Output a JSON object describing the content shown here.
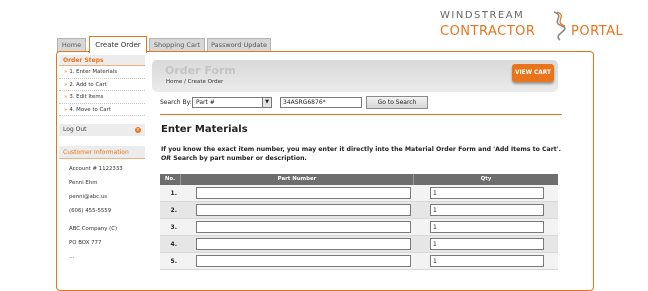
{
  "logo": {
    "line1": "WINDSTREAM",
    "line2": "CONTRACTOR",
    "line3": "PORTAL"
  },
  "tabs": [
    {
      "label": "Home"
    },
    {
      "label": "Create Order"
    },
    {
      "label": "Shopping Cart"
    },
    {
      "label": "Password Update"
    }
  ],
  "sidebar": {
    "order_steps_title": "Order Steps",
    "steps": [
      {
        "label": "1. Enter Materials"
      },
      {
        "label": "2. Add to Cart"
      },
      {
        "label": "3. Edit Items"
      },
      {
        "label": "4. Move to Cart"
      }
    ],
    "logout_label": "Log Out",
    "customer_info_title": "Customer Information",
    "customer": {
      "account": "Account # 1122333",
      "name": "Penni Ehm",
      "email": "penni@abc.us",
      "phone": "(606) 455-5559",
      "company": "ABC Company (C)",
      "po_box": "PO BOX 777",
      "extra": "..."
    }
  },
  "header": {
    "title": "Order Form",
    "breadcrumb": "Home / Create Order",
    "view_cart_label": "VIEW CART"
  },
  "search": {
    "label": "Search By:",
    "select_value": "Part #",
    "input_value": "34ASRG6876*",
    "button_label": "Go to Search"
  },
  "main": {
    "heading": "Enter Materials",
    "instructions_line1": "If you know the exact item number, you may enter it directly into the Material Order Form and 'Add Items to Cart'.",
    "instructions_or": "OR",
    "instructions_line2": "Search by part number or description."
  },
  "table": {
    "headers": {
      "no": "No.",
      "part": "Part Number",
      "qty": "Qty"
    },
    "rows": [
      {
        "no": "1.",
        "part": "",
        "qty": "1"
      },
      {
        "no": "2.",
        "part": "",
        "qty": "1"
      },
      {
        "no": "3.",
        "part": "",
        "qty": "1"
      },
      {
        "no": "4.",
        "part": "",
        "qty": "1"
      },
      {
        "no": "5.",
        "part": "",
        "qty": "1"
      }
    ]
  },
  "colors": {
    "accent": "#e8741c",
    "table_header": "#6d6d6d"
  }
}
